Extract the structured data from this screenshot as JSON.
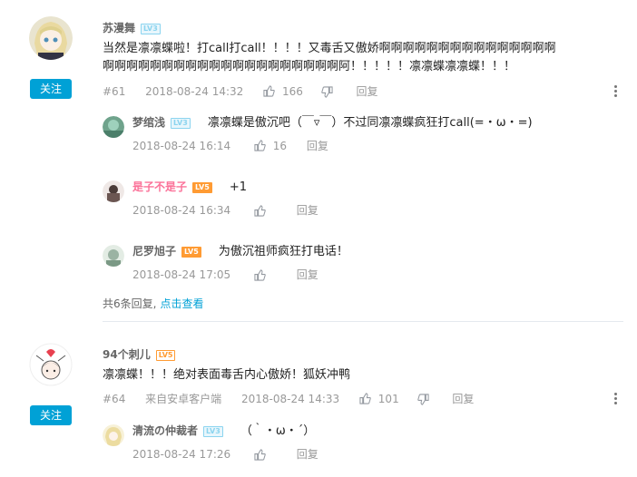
{
  "comments": [
    {
      "user": "苏漫舞",
      "level": "LV3",
      "follow_label": "关注",
      "content_line1": "当然是凛凛蝶啦！打call打call！！！！又毒舌又傲娇啊啊啊啊啊啊啊啊啊啊啊啊啊啊啊",
      "content_line2": "啊啊啊啊啊啊啊啊啊啊啊啊啊啊啊啊啊啊啊啊阿！！！！！凛凛蝶凛凛蝶！！！",
      "floor": "#61",
      "time": "2018-08-24 14:32",
      "likes": "166",
      "reply_label": "回复",
      "replies": [
        {
          "user": "梦绾浅",
          "level": "LV3",
          "content": "凛凛蝶是傲沉吧（￣▿￣）不过同凛凛蝶疯狂打call(=・ω・=)",
          "time": "2018-08-24 16:14",
          "likes": "16",
          "reply_label": "回复"
        },
        {
          "user": "是子不是子",
          "level": "LV5",
          "content": "+1",
          "time": "2018-08-24 16:34",
          "likes": "",
          "reply_label": "回复"
        },
        {
          "user": "尼罗旭子",
          "level": "LV5",
          "content": "为傲沉祖师疯狂打电话！",
          "time": "2018-08-24 17:05",
          "likes": "",
          "reply_label": "回复"
        }
      ],
      "replies_summary": "共6条回复,",
      "view_more": "点击查看"
    },
    {
      "user": "94个刺儿",
      "level": "LV5",
      "follow_label": "关注",
      "content": "凛凛蝶！！！绝对表面毒舌内心傲娇！狐妖冲鸭",
      "floor": "#64",
      "device": "来自安卓客户端",
      "time": "2018-08-24 14:33",
      "likes": "101",
      "reply_label": "回复",
      "replies": [
        {
          "user": "清流の仲裁者",
          "level": "LV3",
          "content": "（｀・ω・´）",
          "time": "2018-08-24 17:26",
          "likes": "",
          "reply_label": "回复"
        }
      ]
    }
  ],
  "colors": {
    "accent": "#00a1d6",
    "vip_pink": "#fb7299",
    "meta": "#999999",
    "lv5": "#ff9b33",
    "lv3": "#8bd4ef"
  },
  "icons": [
    "like-icon",
    "dislike-icon",
    "more-icon"
  ]
}
